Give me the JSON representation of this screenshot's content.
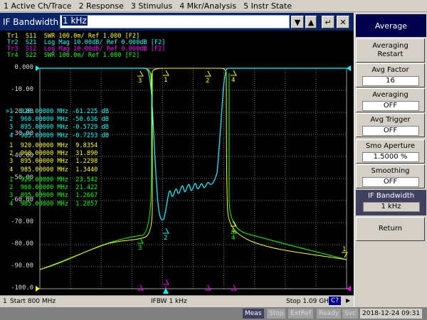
{
  "menu": [
    "1 Active Ch/Trace",
    "2 Response",
    "3 Stimulus",
    "4 Mkr/Analysis",
    "5 Instr State"
  ],
  "entry": {
    "label": "IF Bandwidth",
    "value": "1 kHz",
    "btn_down": "▼",
    "btn_up": "▲",
    "btn_enter": "↵",
    "btn_close": "✕"
  },
  "traces": [
    {
      "text": "Tr1  S11  SWR 100.0m/ Ref 1.000 [F2]",
      "color": "#ffff00"
    },
    {
      "text": "Tr2  S21  Log Mag 10.00dB/ Ref 0.000dB [F2]",
      "color": "#00ffff"
    },
    {
      "text": "Tr3  S12  Log Mag 10.00dB/ Ref 0.000dB [F2]",
      "color": "#ff00ff"
    },
    {
      "text": "Tr4  S22  SWR 100.0m/ Ref 1.000 [F2]",
      "color": "#00ff00"
    }
  ],
  "y_labels": [
    "0.000",
    "-10.00",
    "-20.00",
    "-30.00",
    "-40.00",
    "-50.00",
    "-60.00",
    "-70.00",
    "-80.00",
    "-90.00",
    "-100.0"
  ],
  "markers": {
    "s21": {
      "color": "#00ffff",
      "rows": [
        ">1  920.00000 MHz -61.225 dB",
        " 2  960.00000 MHz -50.636 dB",
        " 3  895.00000 MHz -0.5729 dB",
        " 4  985.00000 MHz -0.7253 dB"
      ]
    },
    "s11": {
      "color": "#ffff00",
      "rows": [
        " 1  920.00000 MHz  9.8354",
        " 2  960.00000 MHz  31.890",
        " 3  895.00000 MHz  1.2298",
        " 4  985.00000 MHz  1.3440"
      ]
    },
    "s22": {
      "color": "#00ff00",
      "rows": [
        " 1  920.00000 MHz  23.542",
        " 2  960.00000 MHz  21.422",
        " 3  895.00000 MHz  1.2667",
        " 4  985.00000 MHz  1.2857"
      ]
    }
  },
  "status": {
    "channel": "1",
    "start": "Start 800 MHz",
    "ifbw": "IFBW 1 kHz",
    "stop": "Stop 1.09 GHz",
    "c_badge": "C?"
  },
  "softkeys": {
    "title": "Average",
    "averaging_restart": "Averaging Restart",
    "avg_factor_label": "Avg Factor",
    "avg_factor_value": "16",
    "averaging_label": "Averaging",
    "averaging_value": "OFF",
    "avg_trigger_label": "Avg Trigger",
    "avg_trigger_value": "OFF",
    "smo_aperture_label": "Smo Aperture",
    "smo_aperture_value": "1.5000 %",
    "smoothing_label": "Smoothing",
    "smoothing_value": "OFF",
    "if_bandwidth_label": "IF Bandwidth",
    "if_bandwidth_value": "1 kHz",
    "return": "Return"
  },
  "infobar": {
    "meas": "Meas",
    "stop": "Stop",
    "extref": "ExtRef",
    "ready": "Ready",
    "svc": "Svc",
    "datetime": "2018-12-24 09:31"
  },
  "colors": {
    "s11": "#ffff00",
    "s21": "#00ffff",
    "s12": "#ff00ff",
    "s22": "#00ff00",
    "grid": "#707070",
    "background": "#000000"
  }
}
